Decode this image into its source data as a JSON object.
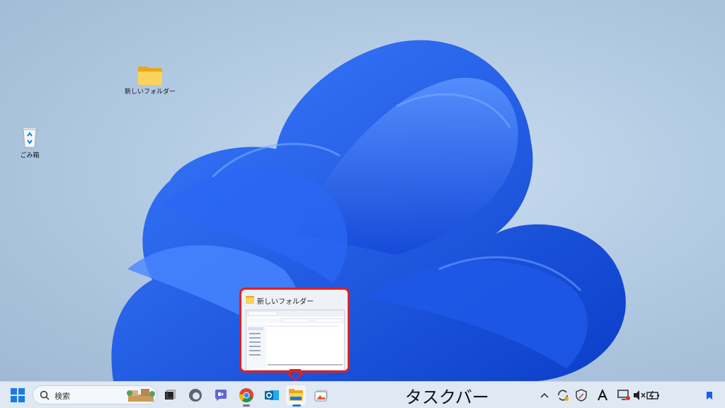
{
  "desktop": {
    "icons": [
      {
        "label": "新しいフォルダー",
        "icon": "folder-icon"
      },
      {
        "label": "ごみ箱",
        "icon": "recycle-bin-icon"
      }
    ]
  },
  "preview": {
    "title": "新しいフォルダー",
    "border_color": "#e02020"
  },
  "taskbar": {
    "start_icon": "windows-start-icon",
    "search_placeholder": "検索",
    "pinned_apps": [
      {
        "name": "task-view-icon"
      },
      {
        "name": "edge-icon"
      },
      {
        "name": "teams-chat-icon"
      },
      {
        "name": "chrome-icon"
      },
      {
        "name": "outlook-icon"
      },
      {
        "name": "file-explorer-icon"
      },
      {
        "name": "gallery-icon"
      }
    ],
    "annotation": "タスクバー",
    "tray_icons": [
      "chevron-up-icon",
      "sync-icon",
      "defender-icon",
      "text-a-icon",
      "network-icon",
      "volume-mute-icon",
      "battery-icon",
      "notification-icon"
    ]
  },
  "colors": {
    "accent": "#1a5fe8",
    "taskbar_bg": "#dfe8f3",
    "highlight": "#e02020"
  }
}
